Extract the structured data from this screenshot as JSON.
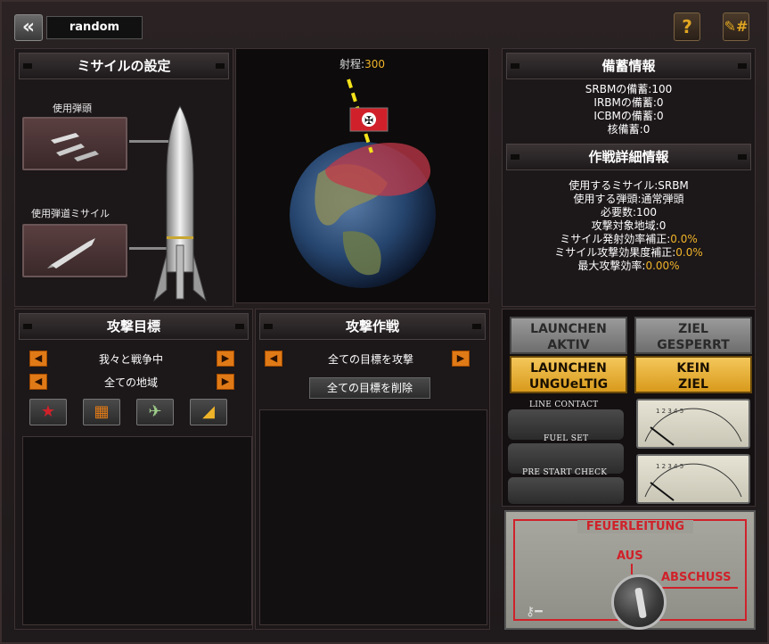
{
  "topbar": {
    "name_value": "random"
  },
  "missile_config": {
    "title": "ミサイルの設定",
    "warhead_label": "使用弾頭",
    "ballistic_label": "使用弾道ミサイル"
  },
  "globe_view": {
    "range_label": "射程:",
    "range_value": "300"
  },
  "stockpile": {
    "title": "備蓄情報",
    "lines": [
      "SRBMの備蓄:100",
      "IRBMの備蓄:0",
      "ICBMの備蓄:0",
      "核備蓄:0"
    ]
  },
  "operation": {
    "title": "作戦詳細情報",
    "lines": [
      {
        "label": "使用するミサイル:SRBM",
        "value": ""
      },
      {
        "label": "使用する弾頭:通常弾頭",
        "value": ""
      },
      {
        "label": "必要数:100",
        "value": ""
      },
      {
        "label": "攻撃対象地域:0",
        "value": ""
      },
      {
        "label": "ミサイル発射効率補正:",
        "value": "0.0%"
      },
      {
        "label": "ミサイル攻撃効果度補正:",
        "value": "0.0%"
      },
      {
        "label": "最大攻撃効率:",
        "value": "0.00%"
      }
    ]
  },
  "targets": {
    "title": "攻撃目標",
    "filter1": "我々と戦争中",
    "filter2": "全ての地域"
  },
  "strategy": {
    "title": "攻撃作戦",
    "filter": "全ての目標を攻撃",
    "delete_label": "全ての目標を削除"
  },
  "controls": {
    "launch_active": [
      "LAUNCHEN",
      "AKTIV"
    ],
    "target_locked": [
      "ZIEL",
      "GESPERRT"
    ],
    "launch_invalid": [
      "LAUNCHEN",
      "UNGUeLTIG"
    ],
    "no_target": [
      "KEIN",
      "ZIEL"
    ],
    "switch1": "LINE CONTACT",
    "switch2": "FUEL SET",
    "switch3": "PRE START CHECK"
  },
  "fire_control": {
    "title": "FEUERLEITUNG",
    "off": "AUS",
    "fire": "ABSCHUSS"
  },
  "colors": {
    "accent": "#f0b429",
    "warning": "#d0212a",
    "orange": "#e07a17"
  }
}
